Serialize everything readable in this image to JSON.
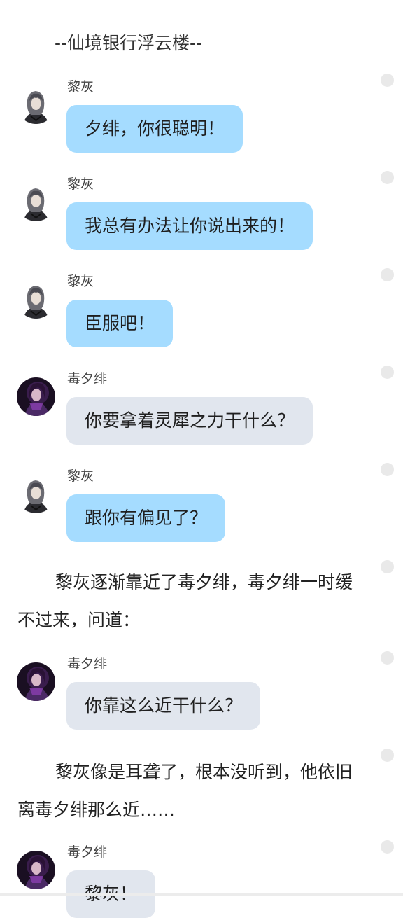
{
  "scene_title": "--仙境银行浮云楼--",
  "characters": {
    "lihui": {
      "name": "黎灰",
      "avatar_icon": "lihui-avatar-icon"
    },
    "duxifei": {
      "name": "毒夕绯",
      "avatar_icon": "duxifei-avatar-icon"
    }
  },
  "messages": [
    {
      "sender": "黎灰",
      "text": "夕绯，你很聪明！"
    },
    {
      "sender": "黎灰",
      "text": "我总有办法让你说出来的！"
    },
    {
      "sender": "黎灰",
      "text": "臣服吧！"
    },
    {
      "sender": "毒夕绯",
      "text": "你要拿着灵犀之力干什么？"
    },
    {
      "sender": "黎灰",
      "text": "跟你有偏见了？"
    },
    {
      "sender": "毒夕绯",
      "text": "你靠这么近干什么？"
    },
    {
      "sender": "毒夕绯",
      "text": "黎灰！"
    }
  ],
  "narrations": [
    "黎灰逐渐靠近了毒夕绯，毒夕绯一时缓不过来，问道：",
    "黎灰像是耳聋了，根本没听到，他依旧离毒夕绯那么近……"
  ],
  "colors": {
    "lihui_bubble": "#a5dcff",
    "duxifei_bubble": "#e1e6ee",
    "background": "#ffffff"
  }
}
